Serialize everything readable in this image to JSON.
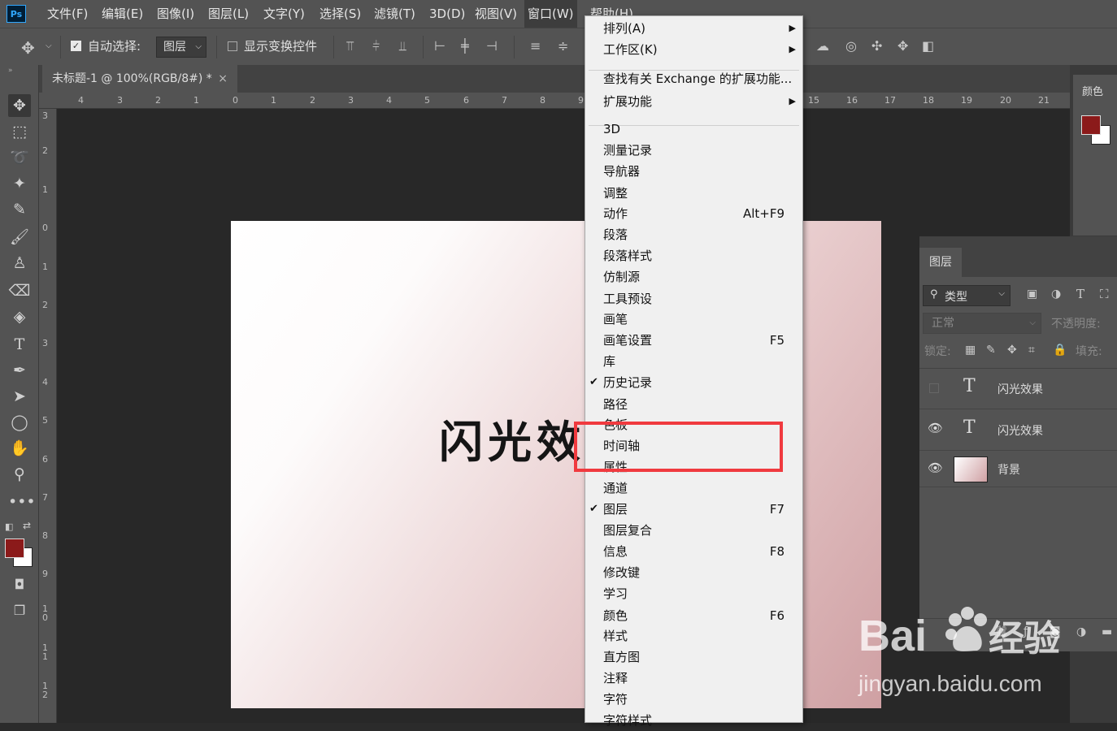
{
  "app": {
    "logo": "Ps"
  },
  "menubar": [
    "文件(F)",
    "编辑(E)",
    "图像(I)",
    "图层(L)",
    "文字(Y)",
    "选择(S)",
    "滤镜(T)",
    "3D(D)",
    "视图(V)",
    "窗口(W)",
    "帮助(H)"
  ],
  "options": {
    "auto_select_label": "自动选择:",
    "layer_select": "图层",
    "show_transform": "显示变换控件"
  },
  "document": {
    "tab_title": "未标题-1 @ 100%(RGB/8#) *",
    "close": "×",
    "text": "闪光效果"
  },
  "rulers": {
    "top": [
      "4",
      "3",
      "2",
      "1",
      "0",
      "1",
      "2",
      "3",
      "4",
      "5",
      "6",
      "7",
      "8",
      "9",
      "15",
      "16",
      "17",
      "18",
      "19",
      "20",
      "21"
    ],
    "left": [
      "3",
      "2",
      "1",
      "0",
      "1",
      "2",
      "3",
      "4",
      "5",
      "6",
      "7",
      "8",
      "9",
      "1\n0",
      "1\n1",
      "1\n2"
    ]
  },
  "panels": {
    "color_title": "颜色",
    "layers_title": "图层",
    "filter_label": "类型",
    "blend_mode": "正常",
    "opacity_label": "不透明度:",
    "lock_label": "锁定:",
    "fill_label": "填充:",
    "layers": [
      {
        "name": "闪光效果",
        "kind": "text",
        "visible": false
      },
      {
        "name": "闪光效果",
        "kind": "text",
        "visible": true
      },
      {
        "name": "背景",
        "kind": "image",
        "visible": true
      }
    ]
  },
  "colors": {
    "foreground": "#8b1a1a",
    "background": "#ffffff",
    "highlight": "#f03a3f"
  },
  "window_menu": {
    "items": [
      {
        "label": "排列(A)",
        "submenu": true,
        "y": 0
      },
      {
        "label": "工作区(K)",
        "submenu": true
      },
      {
        "sep": true
      },
      {
        "label": "查找有关 Exchange 的扩展功能..."
      },
      {
        "label": "扩展功能",
        "submenu": true
      },
      {
        "sep": true
      },
      {
        "label": "3D"
      },
      {
        "label": "测量记录"
      },
      {
        "label": "导航器"
      },
      {
        "label": "调整"
      },
      {
        "label": "动作",
        "shortcut": "Alt+F9"
      },
      {
        "label": "段落"
      },
      {
        "label": "段落样式"
      },
      {
        "label": "仿制源"
      },
      {
        "label": "工具预设"
      },
      {
        "label": "画笔"
      },
      {
        "label": "画笔设置",
        "shortcut": "F5"
      },
      {
        "label": "库"
      },
      {
        "label": "历史记录",
        "checked": true
      },
      {
        "label": "路径"
      },
      {
        "label": "色板"
      },
      {
        "label": "时间轴"
      },
      {
        "label": "属性"
      },
      {
        "label": "通道"
      },
      {
        "label": "图层",
        "shortcut": "F7",
        "checked": true
      },
      {
        "label": "图层复合"
      },
      {
        "label": "信息",
        "shortcut": "F8"
      },
      {
        "label": "修改键"
      },
      {
        "label": "学习"
      },
      {
        "label": "颜色",
        "shortcut": "F6"
      },
      {
        "label": "样式"
      },
      {
        "label": "直方图"
      },
      {
        "label": "注释"
      },
      {
        "label": "字符"
      },
      {
        "label": "字符样式"
      }
    ]
  },
  "watermark": {
    "brand": "Bai",
    "brand_suffix": "经验",
    "url": "jingyan.baidu.com"
  }
}
